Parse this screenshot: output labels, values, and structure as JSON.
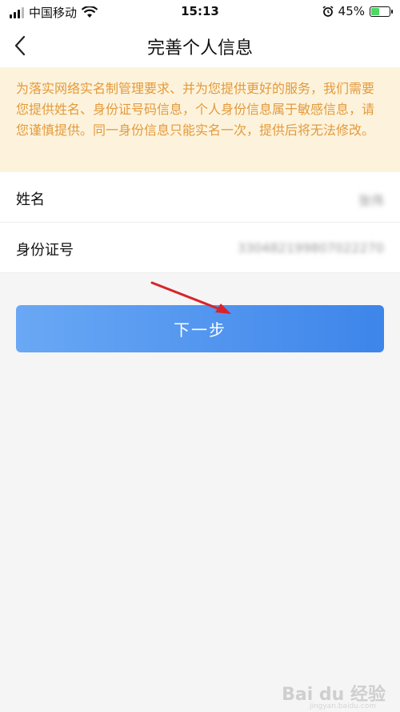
{
  "status_bar": {
    "carrier": "中国移动",
    "time": "15:13",
    "battery": "45%"
  },
  "nav": {
    "title": "完善个人信息"
  },
  "notice": {
    "text": "为落实网络实名制管理要求、并为您提供更好的服务，我们需要您提供姓名、身份证号码信息，个人身份信息属于敏感信息，请您谨慎提供。同一身份信息只能实名一次，提供后将无法修改。"
  },
  "form": {
    "name_label": "姓名",
    "name_value": "张伟",
    "id_label": "身份证号",
    "id_value": "330482199807022270"
  },
  "button": {
    "next_label": "下一步"
  },
  "watermark": {
    "text": "Bai du 经验",
    "sub": "jingyan.baidu.com"
  },
  "colors": {
    "notice_bg": "#fdf3dc",
    "notice_text": "#e39a3c",
    "button_start": "#6aa8f5",
    "button_end": "#3d85ea",
    "arrow": "#d9232a"
  },
  "icons": [
    "signal-icon",
    "wifi-icon",
    "alarm-icon",
    "battery-icon",
    "back-chevron-icon",
    "annotation-arrow"
  ]
}
